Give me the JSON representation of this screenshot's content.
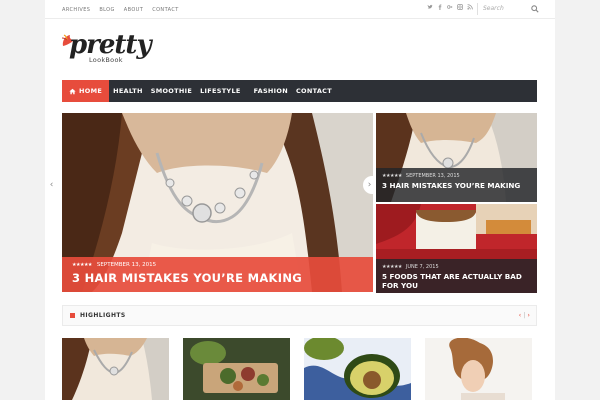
{
  "topbar": {
    "links": [
      "ARCHIVES",
      "BLOG",
      "ABOUT",
      "CONTACT"
    ],
    "social_icons": [
      "twitter-icon",
      "facebook-icon",
      "google-plus-icon",
      "instagram-icon",
      "rss-icon"
    ],
    "search_placeholder": "Search"
  },
  "logo": {
    "script": "pretty",
    "subtitle": "LookBook"
  },
  "nav": {
    "items": [
      "HOME",
      "HEALTH",
      "SMOOTHIE",
      "LIFESTYLE",
      "FASHION",
      "CONTACT"
    ]
  },
  "slider": {
    "main": {
      "stars": "★★★★★",
      "date": "SEPTEMBER 13, 2015",
      "title": "3 HAIR MISTAKES YOU’RE MAKING"
    },
    "side": [
      {
        "stars": "★★★★★",
        "date": "SEPTEMBER 13, 2015",
        "title": "3 HAIR MISTAKES YOU’RE MAKING"
      },
      {
        "stars": "★★★★★",
        "date": "JUNE 7, 2015",
        "title": "5 FOODS THAT ARE ACTUALLY BAD FOR YOU"
      }
    ]
  },
  "highlights": {
    "label": "HIGHLIGHTS"
  },
  "colors": {
    "accent": "#e74c3c",
    "nav_bg": "#2d3036"
  }
}
